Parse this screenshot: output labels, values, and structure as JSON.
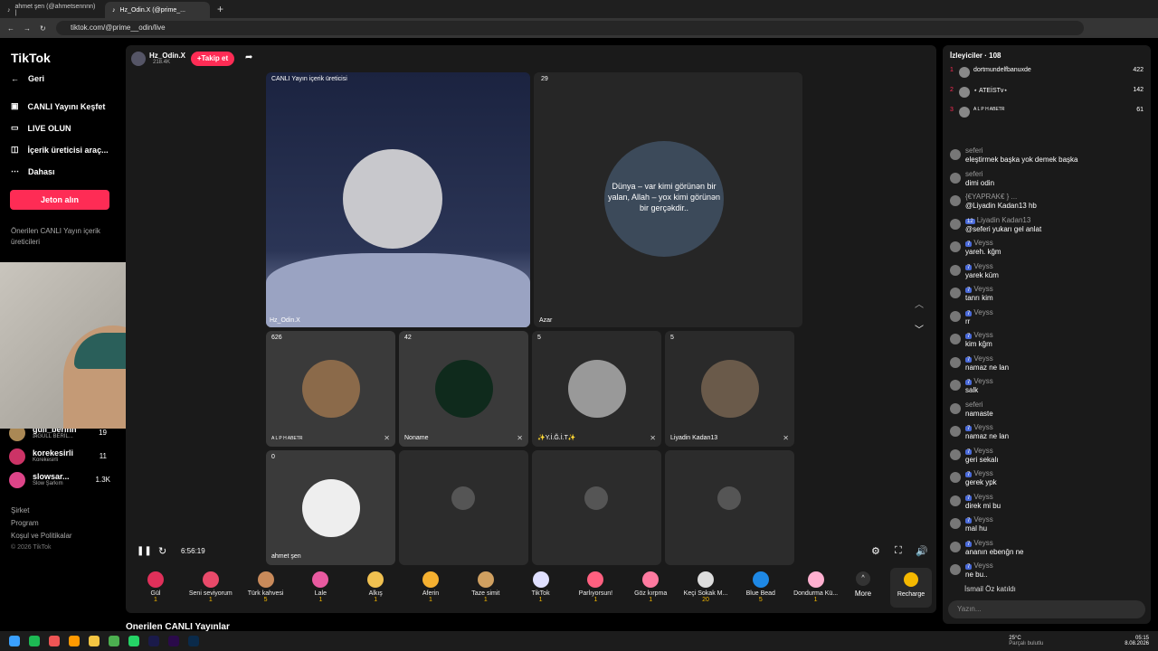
{
  "tabs": [
    {
      "title": "ahmet şen (@ahmetsennnn) |"
    },
    {
      "title": "Hz_Odin.X (@prime_..."
    }
  ],
  "address": "tiktok.com/@prime__odin/live",
  "sidebar": {
    "logo": "TikTok",
    "back": "Geri",
    "items": [
      "CANLI Yayını Keşfet",
      "LIVE OLUN",
      "İçerik üreticisi araç...",
      "Dahası"
    ],
    "coin_button": "Jeton alın",
    "suggested_title": "Önerilen CANLI Yayın içerik üreticileri",
    "creators": [
      {
        "name": "gull_berinn",
        "sub": "ɪʀGÜLL BERİL...",
        "count": "19"
      },
      {
        "name": "korekesirli",
        "sub": "Korekesirli",
        "count": "11"
      },
      {
        "name": "slowsar...",
        "sub": "Slow Şarkım",
        "count": "1.3K"
      }
    ],
    "footer": [
      "Şirket",
      "Program",
      "Koşul ve Politikalar",
      "© 2026 TikTok"
    ]
  },
  "host": {
    "name": "Hz_Odin.X",
    "likes": "218.4K",
    "follow": "+Takip et"
  },
  "stage": {
    "main_label": "CANLI Yayın içerik üreticisi",
    "main_name": "Hz_Odin.X",
    "second_count": "29",
    "second_name": "Azar",
    "quote": "Dünya – var kimi görünən bir yalan, Allah – yox kimi görünən bir gerçəkdir..",
    "guests": [
      {
        "count": "626",
        "name": "A L P H ABETR"
      },
      {
        "count": "42",
        "name": "Noname"
      },
      {
        "count": "5",
        "name": "✨Y.İ.Ğ.İ.T✨"
      },
      {
        "count": "5",
        "name": "Liyadin Kadan13"
      },
      {
        "count": "0",
        "name": "ahmet şen"
      }
    ],
    "time": "6:56:19"
  },
  "gifts": [
    {
      "name": "Gül",
      "price": "1"
    },
    {
      "name": "Seni seviyorum",
      "price": "1"
    },
    {
      "name": "Türk kahvesi",
      "price": "5"
    },
    {
      "name": "Lale",
      "price": "1"
    },
    {
      "name": "Alkış",
      "price": "1"
    },
    {
      "name": "Aferin",
      "price": "1"
    },
    {
      "name": "Taze simit",
      "price": "1"
    },
    {
      "name": "TikTok",
      "price": "1"
    },
    {
      "name": "Parlıyorsun!",
      "price": "1"
    },
    {
      "name": "Göz kırpma",
      "price": "1"
    },
    {
      "name": "Keçi Sokak M...",
      "price": "20"
    },
    {
      "name": "Blue Bead",
      "price": "5"
    },
    {
      "name": "Dondurma Kü...",
      "price": "1"
    }
  ],
  "more": "More",
  "recharge": "Recharge",
  "bottom_heading": "Önerilen CANLI Yayınlar",
  "viewers": {
    "title": "İzleyiciler · 108",
    "list": [
      {
        "rank": "1",
        "name": "dortmundelfbanuxde",
        "score": "422"
      },
      {
        "rank": "2",
        "name": "⋆ ATEİSTv⋆",
        "score": "142"
      },
      {
        "rank": "3",
        "name": "A L P H ABETR",
        "score": "61"
      }
    ]
  },
  "chat": [
    {
      "name": "seferi",
      "text": "eleştirmek başka yok demek başka"
    },
    {
      "name": "seferi",
      "text": "dimi odin"
    },
    {
      "name": "{€YAPRAK€ } ...",
      "text": "@Liyadin Kadan13 hb"
    },
    {
      "name": "Liyadin Kadan13",
      "text": "@seferi yukarı gel anlat",
      "lvl": "12"
    },
    {
      "name": "Veyss",
      "text": "yareh. kğm",
      "lvl": "7"
    },
    {
      "name": "Veyss",
      "text": "yarek küm",
      "lvl": "7"
    },
    {
      "name": "Veyss",
      "text": "tanrı kim",
      "lvl": "7"
    },
    {
      "name": "Veyss",
      "text": "rr",
      "lvl": "7"
    },
    {
      "name": "Veyss",
      "text": "kim kğm",
      "lvl": "7"
    },
    {
      "name": "Veyss",
      "text": "namaz ne lan",
      "lvl": "7"
    },
    {
      "name": "Veyss",
      "text": "salk",
      "lvl": "7"
    },
    {
      "name": "seferi",
      "text": "namaste"
    },
    {
      "name": "Veyss",
      "text": "namaz ne lan",
      "lvl": "7"
    },
    {
      "name": "Veyss",
      "text": "geri sekalı",
      "lvl": "7"
    },
    {
      "name": "Veyss",
      "text": "gerek ypk",
      "lvl": "7"
    },
    {
      "name": "Veyss",
      "text": "direk mi bu",
      "lvl": "7"
    },
    {
      "name": "Veyss",
      "text": "mal hu",
      "lvl": "7"
    },
    {
      "name": "Veyss",
      "text": "ananın ebenğn ne",
      "lvl": "7"
    },
    {
      "name": "Veyss",
      "text": "ne bu..",
      "lvl": "7"
    }
  ],
  "joined": "İsmail Öz  katıldı",
  "chat_placeholder": "Yazın...",
  "taskbar": {
    "weather": "25°C",
    "weather_sub": "Parçalı bulutlu",
    "time": "05:15",
    "date": "8.08.2026"
  }
}
